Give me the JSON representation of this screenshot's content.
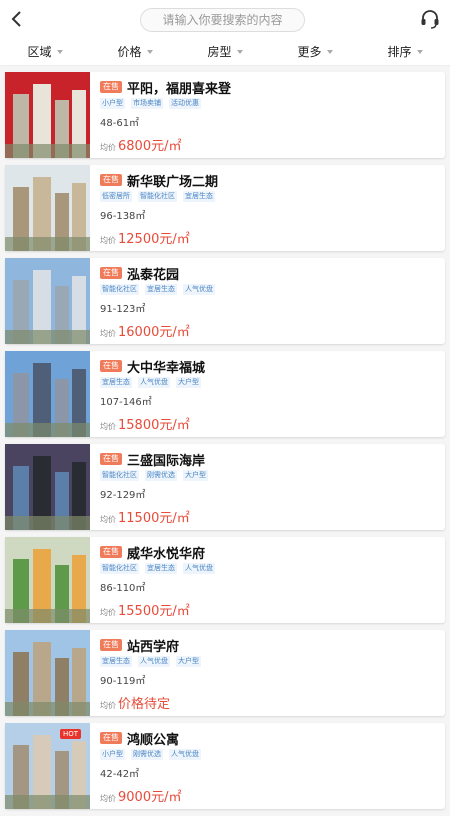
{
  "header": {
    "search_placeholder": "请输入你要搜索的内容",
    "back_icon": "chevron-left-icon",
    "support_icon": "headset-icon"
  },
  "filters": [
    "区域",
    "价格",
    "房型",
    "更多",
    "排序"
  ],
  "colors": {
    "accent": "#e84b3a",
    "status": "#f07b5a",
    "tag": "#4a86c5"
  },
  "listings": [
    {
      "status": "在售",
      "name": "平阳，福朋喜来登",
      "tags": [
        "小户型",
        "市场卖铺",
        "活动优惠"
      ],
      "area": "48-61㎡",
      "price_label": "均价",
      "price": "6800元/㎡",
      "hot": ""
    },
    {
      "status": "在售",
      "name": "新华联广场二期",
      "tags": [
        "低密居所",
        "智能化社区",
        "宜居生态"
      ],
      "area": "96-138㎡",
      "price_label": "均价",
      "price": "12500元/㎡",
      "hot": ""
    },
    {
      "status": "在售",
      "name": "泓泰花园",
      "tags": [
        "智能化社区",
        "宜居生态",
        "人气优盘"
      ],
      "area": "91-123㎡",
      "price_label": "均价",
      "price": "16000元/㎡",
      "hot": ""
    },
    {
      "status": "在售",
      "name": "大中华幸福城",
      "tags": [
        "宜居生态",
        "人气优盘",
        "大户型"
      ],
      "area": "107-146㎡",
      "price_label": "均价",
      "price": "15800元/㎡",
      "hot": ""
    },
    {
      "status": "在售",
      "name": "三盛国际海岸",
      "tags": [
        "智能化社区",
        "刚需优选",
        "大户型"
      ],
      "area": "92-129㎡",
      "price_label": "均价",
      "price": "11500元/㎡",
      "hot": ""
    },
    {
      "status": "在售",
      "name": "威华水悦华府",
      "tags": [
        "智能化社区",
        "宜居生态",
        "人气优盘"
      ],
      "area": "86-110㎡",
      "price_label": "均价",
      "price": "15500元/㎡",
      "hot": ""
    },
    {
      "status": "在售",
      "name": "站西学府",
      "tags": [
        "宜居生态",
        "人气优盘",
        "大户型"
      ],
      "area": "90-119㎡",
      "price_label": "均价",
      "price": "价格待定",
      "hot": ""
    },
    {
      "status": "在售",
      "name": "鸿顺公寓",
      "tags": [
        "小户型",
        "刚需优选",
        "人气优盘"
      ],
      "area": "42-42㎡",
      "price_label": "均价",
      "price": "9000元/㎡",
      "hot": "HOT"
    }
  ]
}
